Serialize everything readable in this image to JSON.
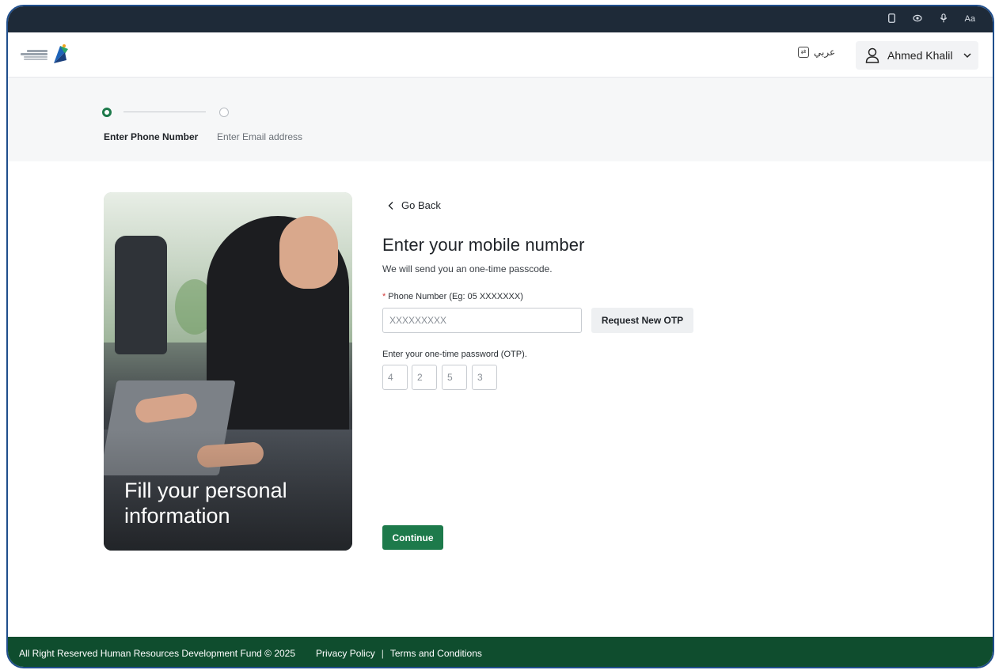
{
  "system_bar": {
    "icons": [
      "phone-icon",
      "eye-icon",
      "mic-icon",
      "text-size-icon"
    ],
    "text_size_label": "Aa"
  },
  "header": {
    "logo_text_ar": "صندوق تنمية الموارد البشرية",
    "logo_text_en": "HUMAN RESOURCES DEVELOPMENT FUND",
    "lang_label": "عربي",
    "user_name": "Ahmed Khalil"
  },
  "stepper": {
    "steps": [
      {
        "label": "Enter Phone Number",
        "active": true
      },
      {
        "label": "Enter Email address",
        "active": false
      }
    ]
  },
  "card": {
    "caption": "Fill your personal information"
  },
  "form": {
    "go_back": "Go Back",
    "title": "Enter your mobile number",
    "subtitle": "We will send you an one-time passcode.",
    "phone_label": "Phone Number (Eg: 05 XXXXXXX)",
    "phone_placeholder": "XXXXXXXXX",
    "request_otp": "Request New OTP",
    "otp_label": "Enter your one-time password (OTP).",
    "otp_digits": [
      "4",
      "2",
      "5",
      "3"
    ],
    "continue": "Continue"
  },
  "footer": {
    "copyright": "All Right Reserved Human Resources Development Fund © 2025",
    "privacy": "Privacy Policy",
    "separator": "|",
    "terms": "Terms and Conditions"
  },
  "colors": {
    "primary_green": "#1d7a4b",
    "footer_green": "#0f4d2e",
    "system_bar": "#1e2a38"
  }
}
